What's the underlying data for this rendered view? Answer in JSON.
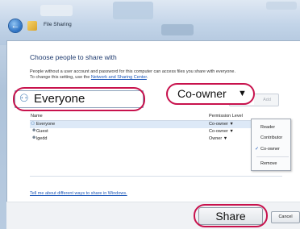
{
  "window": {
    "title": "File Sharing",
    "icons": {
      "back": "back-arrow-icon",
      "app": "folder-share-icon"
    }
  },
  "dialog": {
    "heading": "Choose people to share with",
    "description_line1": "People without a user account and password for this computer can access files you share with everyone.",
    "description_line2_prefix": "To change this setting, use the ",
    "description_link": "Network and Sharing Center",
    "description_line2_suffix": "."
  },
  "name_input": {
    "value": "Everyone",
    "icon": "users-icon"
  },
  "permission_select": {
    "value": "Co-owner",
    "caret": "▼"
  },
  "add_button": "Add",
  "table": {
    "headers": {
      "name": "Name",
      "permission": "Permission Level"
    },
    "rows": [
      {
        "name": "Everyone",
        "permission": "Co-owner ▼",
        "icon": "group-icon"
      },
      {
        "name": "Guest",
        "permission": "Co-owner ▼",
        "icon": "user-icon"
      },
      {
        "name": "lgedd",
        "permission": "Owner ▼",
        "icon": "user-icon"
      }
    ]
  },
  "permission_menu": {
    "items": [
      "Reader",
      "Contributor",
      "Co-owner",
      "Remove"
    ],
    "checked": "Co-owner",
    "check_glyph": "✓"
  },
  "help_link": "Tell me about different ways to share in Windows.",
  "buttons": {
    "share": "Share",
    "cancel": "Cancel"
  },
  "colors": {
    "accent_link": "#1a55b7",
    "highlight_ring": "#c8124d"
  }
}
